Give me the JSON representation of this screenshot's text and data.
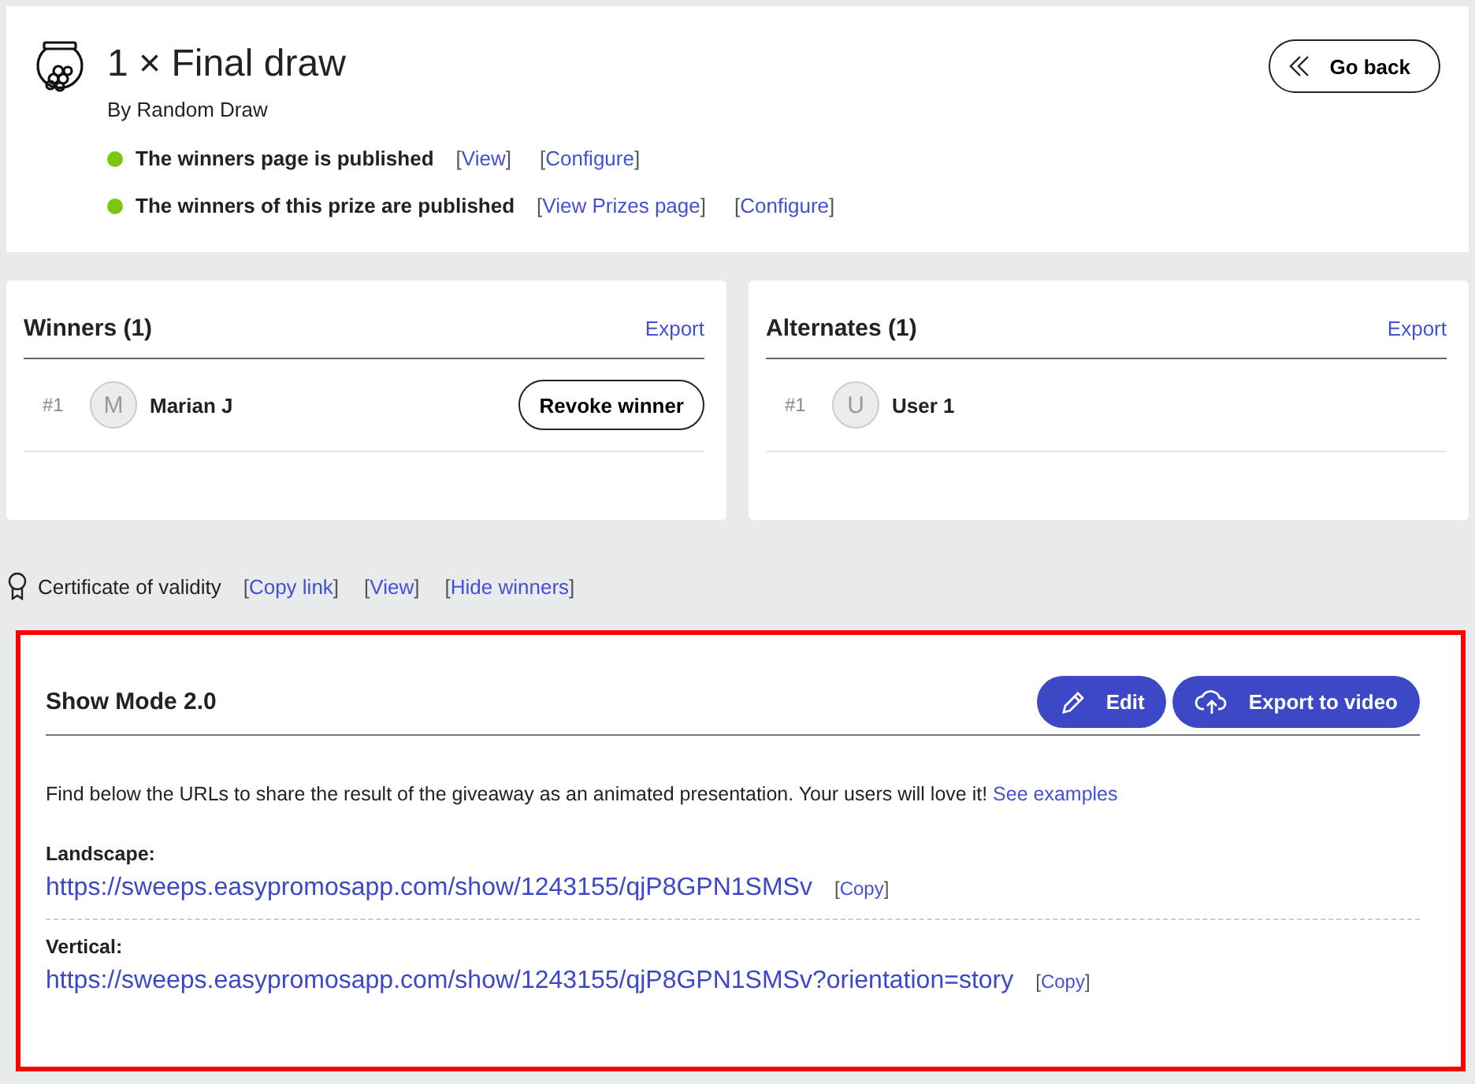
{
  "header": {
    "title": "1 × Final draw",
    "subtitle": "By Random Draw",
    "back_button": "Go back",
    "statuses": [
      {
        "text": "The winners page is published",
        "color": "#7ac70c",
        "links": [
          {
            "open": "[",
            "label": "View",
            "close": "]"
          },
          {
            "open": "[",
            "label": "Configure",
            "close": "]"
          }
        ]
      },
      {
        "text": "The winners of this prize are published",
        "color": "#7ac70c",
        "links": [
          {
            "open": "[",
            "label": "View Prizes page",
            "close": "]"
          },
          {
            "open": "[",
            "label": "Configure",
            "close": "]"
          }
        ]
      }
    ]
  },
  "lists": [
    {
      "title": "Winners (1)",
      "export": "Export",
      "rows": [
        {
          "rank": "#1",
          "initial": "M",
          "name": "Marian J",
          "action": "Revoke winner"
        }
      ]
    },
    {
      "title": "Alternates (1)",
      "export": "Export",
      "rows": [
        {
          "rank": "#1",
          "initial": "U",
          "name": "User 1"
        }
      ]
    }
  ],
  "certificate": {
    "label": "Certificate of validity",
    "links": [
      {
        "open": "[",
        "label": "Copy link",
        "close": "]"
      },
      {
        "open": "[",
        "label": "View",
        "close": "]"
      },
      {
        "open": "[",
        "label": "Hide winners",
        "close": "]"
      }
    ]
  },
  "show_mode": {
    "title": "Show Mode 2.0",
    "buttons": [
      {
        "kind": "edit",
        "label": "Edit"
      },
      {
        "kind": "export",
        "label": "Export to video"
      }
    ],
    "description": "Find below the URLs to share the result of the giveaway as an animated presentation. Your users will love it!",
    "description_link": "See examples",
    "urls": [
      {
        "label": "Landscape:",
        "url": "https://sweeps.easypromosapp.com/show/1243155/qjP8GPN1SMSv",
        "copy": {
          "open": "[",
          "label": "Copy",
          "close": "]"
        }
      },
      {
        "label": "Vertical:",
        "url": "https://sweeps.easypromosapp.com/show/1243155/qjP8GPN1SMSv?orientation=story",
        "copy": {
          "open": "[",
          "label": "Copy",
          "close": "]"
        }
      }
    ]
  }
}
